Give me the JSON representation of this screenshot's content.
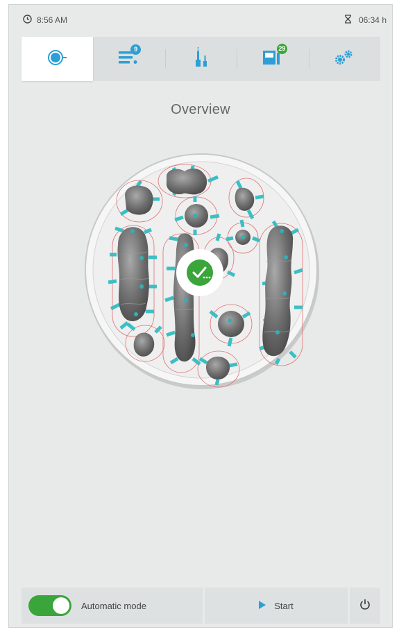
{
  "status": {
    "time": "8:56 AM",
    "remaining": "06:34 h",
    "clock_icon": "clock-icon",
    "hourglass_icon": "hourglass-icon"
  },
  "nav": {
    "tabs": [
      {
        "name": "overview",
        "icon": "disk-overview-icon",
        "active": true
      },
      {
        "name": "job-list",
        "icon": "job-list-icon",
        "badge": "9"
      },
      {
        "name": "tools",
        "icon": "milling-tools-icon"
      },
      {
        "name": "material",
        "icon": "material-block-icon",
        "badge": "29"
      },
      {
        "name": "settings",
        "icon": "gears-icon"
      }
    ],
    "active_color": "#2b9fd6",
    "badge_blue": "#2b9fd6",
    "badge_green": "#3aa53a"
  },
  "page": {
    "title": "Overview"
  },
  "disk": {
    "status_icon": "check-processing-icon",
    "status_text": "✓...",
    "accent": "#3bbfc4"
  },
  "bottom": {
    "automatic_mode_label": "Automatic mode",
    "automatic_mode_on": true,
    "start_label": "Start",
    "power_icon": "power-icon"
  }
}
